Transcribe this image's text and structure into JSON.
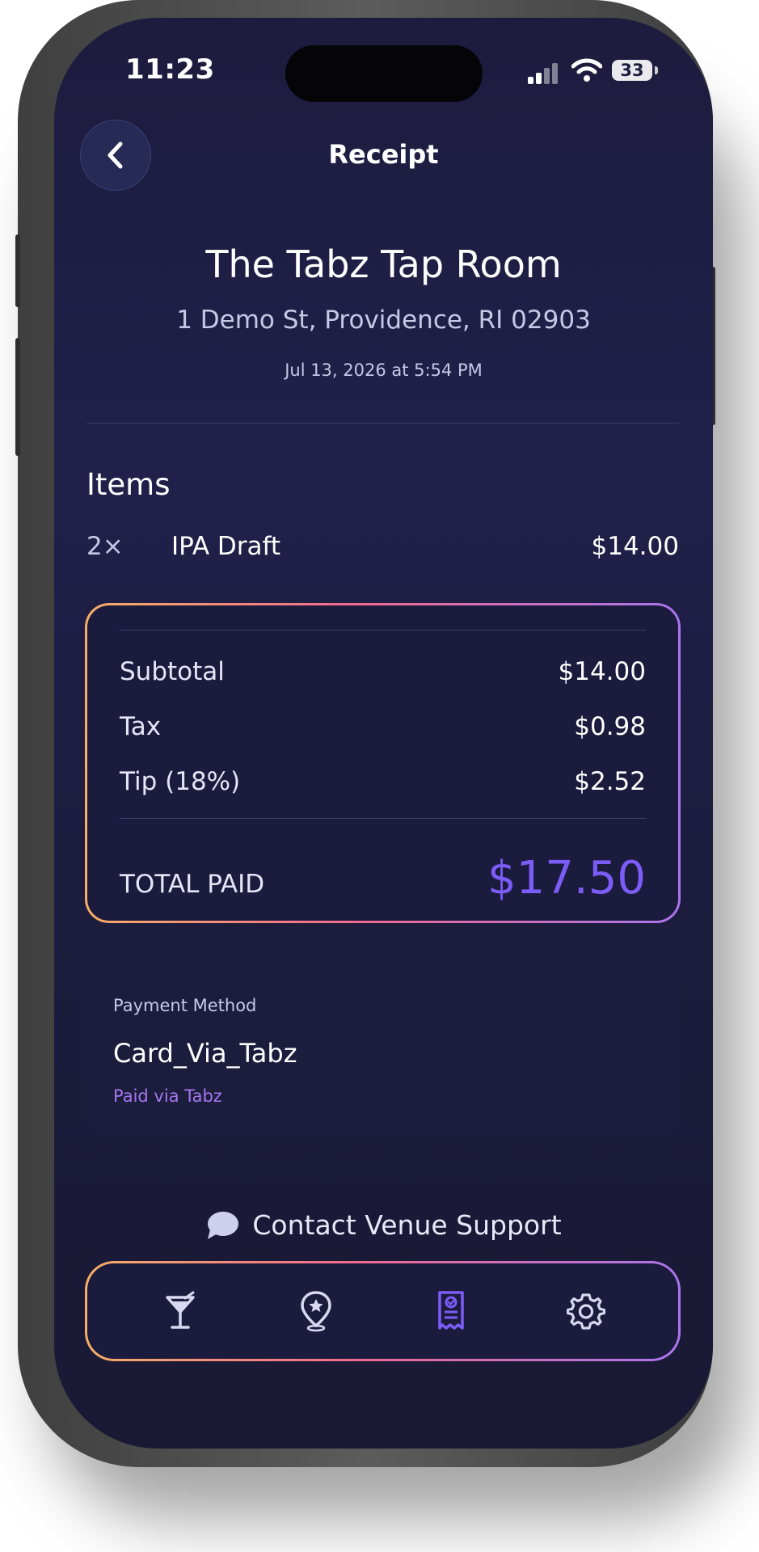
{
  "status_bar": {
    "time": "11:23",
    "battery": "33"
  },
  "header": {
    "title": "Receipt",
    "back_icon": "chevron-left-icon"
  },
  "venue": {
    "name": "The Tabz Tap Room",
    "address": "1 Demo St, Providence, RI 02903",
    "date": "Jul 13, 2026 at 5:54 PM"
  },
  "items": {
    "heading": "Items",
    "list": [
      {
        "qty": "2×",
        "name": "IPA Draft",
        "price": "$14.00"
      }
    ]
  },
  "summary": {
    "subtotal_label": "Subtotal",
    "subtotal": "$14.00",
    "tax_label": "Tax",
    "tax": "$0.98",
    "tip_label": "Tip (18%)",
    "tip": "$2.52",
    "total_label": "TOTAL PAID",
    "total": "$17.50"
  },
  "payment": {
    "label": "Payment Method",
    "method": "Card_Via_Tabz",
    "note": "Paid via Tabz"
  },
  "support": {
    "label": "Contact Venue Support",
    "icon": "chat-bubble-icon"
  },
  "tabbar": {
    "tabs": [
      {
        "icon": "cocktail-glass-icon",
        "active": false
      },
      {
        "icon": "map-pin-star-icon",
        "active": false
      },
      {
        "icon": "receipt-check-icon",
        "active": true
      },
      {
        "icon": "gear-icon",
        "active": false
      }
    ]
  },
  "colors": {
    "background": "#1d1c3e",
    "accent": "#7c5cf7",
    "accent_light": "#a777ee",
    "gradient_start": "#f6ae66",
    "gradient_mid": "#f06a8e",
    "gradient_end": "#a975ec"
  }
}
